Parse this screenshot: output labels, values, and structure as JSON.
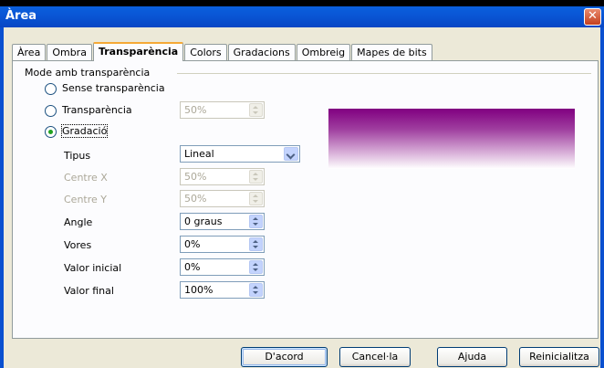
{
  "window": {
    "title": "Àrea",
    "close_glyph": "✕"
  },
  "tabs": [
    {
      "label": "Àrea",
      "active": false
    },
    {
      "label": "Ombra",
      "active": false
    },
    {
      "label": "Transparència",
      "active": true
    },
    {
      "label": "Colors",
      "active": false
    },
    {
      "label": "Gradacions",
      "active": false
    },
    {
      "label": "Ombreig",
      "active": false
    },
    {
      "label": "Mapes de bits",
      "active": false
    }
  ],
  "mode_group": {
    "label": "Mode amb transparència",
    "options": [
      {
        "label": "Sense transparència",
        "checked": false
      },
      {
        "label": "Transparència",
        "checked": false,
        "value": "50%",
        "enabled": false
      },
      {
        "label": "Gradació",
        "checked": true
      }
    ]
  },
  "gradient": {
    "type": {
      "label": "Tipus",
      "value": "Lineal"
    },
    "center_x": {
      "label": "Centre X",
      "value": "50%",
      "enabled": false
    },
    "center_y": {
      "label": "Centre Y",
      "value": "50%",
      "enabled": false
    },
    "angle": {
      "label": "Angle",
      "value": "0 graus"
    },
    "border": {
      "label": "Vores",
      "value": "0%"
    },
    "start_value": {
      "label": "Valor inicial",
      "value": "0%"
    },
    "end_value": {
      "label": "Valor final",
      "value": "100%"
    }
  },
  "preview": {
    "color_top": "#800080",
    "color_bottom": "#ffffff"
  },
  "buttons": {
    "ok": "D'acord",
    "cancel": "Cancel·la",
    "help": "Ajuda",
    "reset": "Reinicialitza"
  },
  "colors": {
    "titlebar": "#0a57d6",
    "dialog_bg": "#ece9d8",
    "active_tab_accent": "#f5a936"
  }
}
